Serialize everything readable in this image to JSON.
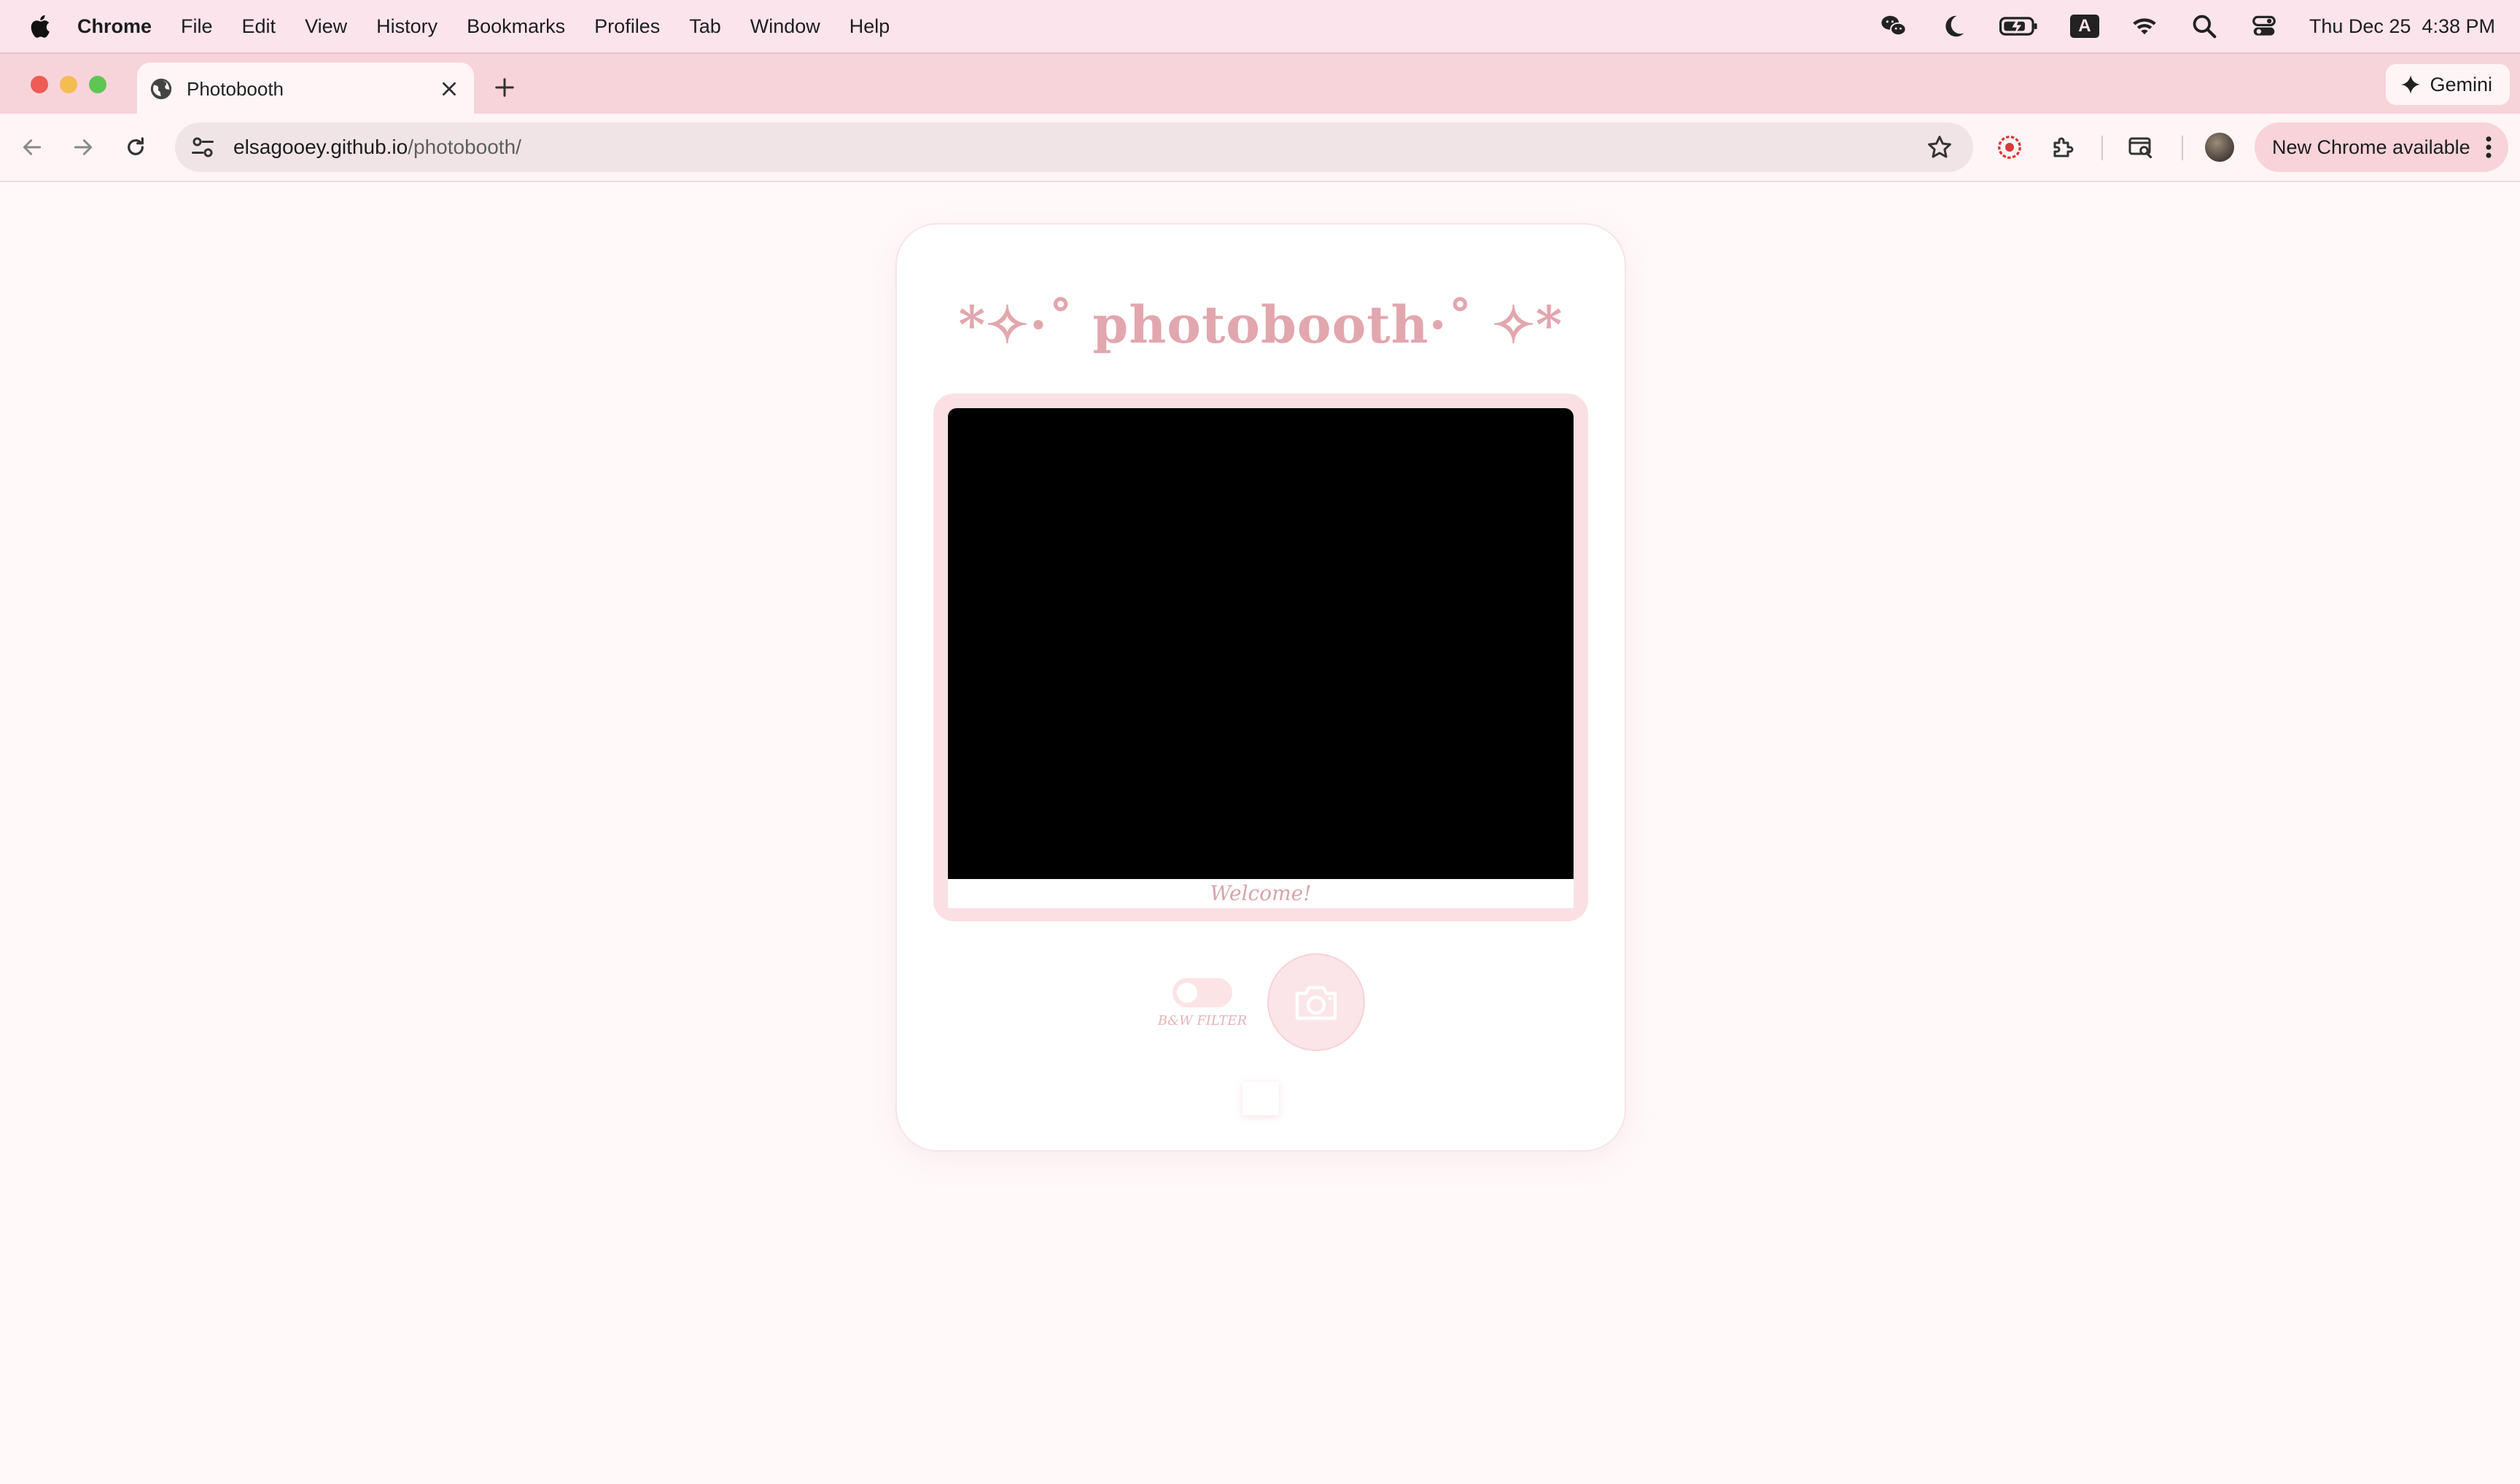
{
  "menubar": {
    "app_name": "Chrome",
    "items": [
      "File",
      "Edit",
      "View",
      "History",
      "Bookmarks",
      "Profiles",
      "Tab",
      "Window",
      "Help"
    ],
    "clock": "Thu Dec 25  4:38 PM",
    "input_source": "A"
  },
  "browser": {
    "tab_title": "Photobooth",
    "gemini_label": "Gemini",
    "url_host": "elsagooey.github.io",
    "url_path": "/photobooth/",
    "update_label": "New Chrome available"
  },
  "app": {
    "title": "*✧·˚ photobooth·˚ ✧*",
    "caption": "Welcome!",
    "filter_label": "B&W FILTER",
    "filter_on": false
  },
  "colors": {
    "accent_pink": "#e2a7ae",
    "frame_pink": "#fae0e3",
    "menubar_bg": "#fce4ec"
  }
}
